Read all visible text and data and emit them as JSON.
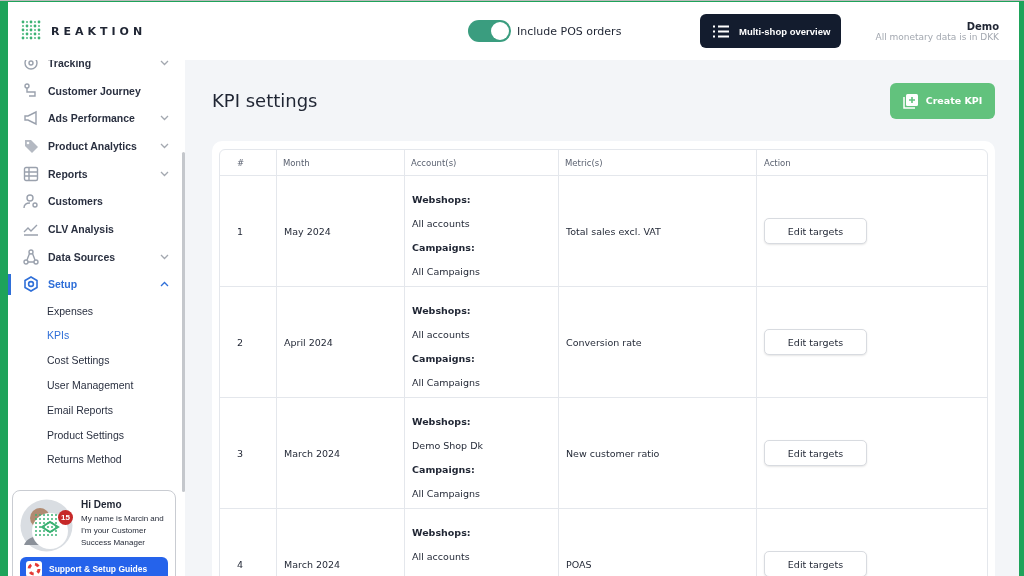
{
  "brand": "REAKTION",
  "header": {
    "pos_toggle": {
      "label": "Include POS orders",
      "on": true
    },
    "overview_button": "Multi-shop overview",
    "user": {
      "name": "Demo",
      "note": "All monetary data is in DKK"
    }
  },
  "sidebar": {
    "items": [
      {
        "label": "Tracking",
        "expanded": false,
        "selected": false
      },
      {
        "label": "Customer Journey",
        "selected": false
      },
      {
        "label": "Ads Performance",
        "expanded": false,
        "selected": false
      },
      {
        "label": "Product Analytics",
        "expanded": false,
        "selected": false
      },
      {
        "label": "Reports",
        "expanded": false,
        "selected": false
      },
      {
        "label": "Customers",
        "selected": false
      },
      {
        "label": "CLV Analysis",
        "selected": false
      },
      {
        "label": "Data Sources",
        "expanded": false,
        "selected": false
      },
      {
        "label": "Setup",
        "expanded": true,
        "selected": true,
        "children": [
          {
            "label": "Expenses",
            "selected": false
          },
          {
            "label": "KPIs",
            "selected": true
          },
          {
            "label": "Cost Settings",
            "selected": false
          },
          {
            "label": "User Management",
            "selected": false
          },
          {
            "label": "Email Reports",
            "selected": false
          },
          {
            "label": "Product Settings",
            "selected": false
          },
          {
            "label": "Returns Method",
            "selected": false
          }
        ]
      }
    ]
  },
  "support_card": {
    "greeting": "Hi Demo",
    "message": "My name is Marcin and I'm your Customer Success Manager",
    "badge": "15",
    "button": "Support & Setup Guides"
  },
  "page": {
    "title": "KPI settings",
    "create_button": "Create KPI"
  },
  "table": {
    "columns": [
      "#",
      "Month",
      "Account(s)",
      "Metric(s)",
      "Action"
    ],
    "rows": [
      {
        "index": "1",
        "month": "May 2024",
        "accounts": [
          {
            "heading": "Webshops:",
            "value": "All accounts"
          },
          {
            "heading": "Campaigns:",
            "value": "All Campaigns"
          }
        ],
        "metric": "Total sales excl. VAT",
        "action": "Edit targets"
      },
      {
        "index": "2",
        "month": "April 2024",
        "accounts": [
          {
            "heading": "Webshops:",
            "value": "All accounts"
          },
          {
            "heading": "Campaigns:",
            "value": "All Campaigns"
          }
        ],
        "metric": "Conversion rate",
        "action": "Edit targets"
      },
      {
        "index": "3",
        "month": "March 2024",
        "accounts": [
          {
            "heading": "Webshops:",
            "value": "Demo Shop Dk"
          },
          {
            "heading": "Campaigns:",
            "value": "All Campaigns"
          }
        ],
        "metric": "New customer ratio",
        "action": "Edit targets"
      },
      {
        "index": "4",
        "month": "March 2024",
        "accounts": [
          {
            "heading": "Webshops:",
            "value": "All accounts"
          }
        ],
        "metric": "POAS",
        "action": "Edit targets"
      }
    ]
  }
}
